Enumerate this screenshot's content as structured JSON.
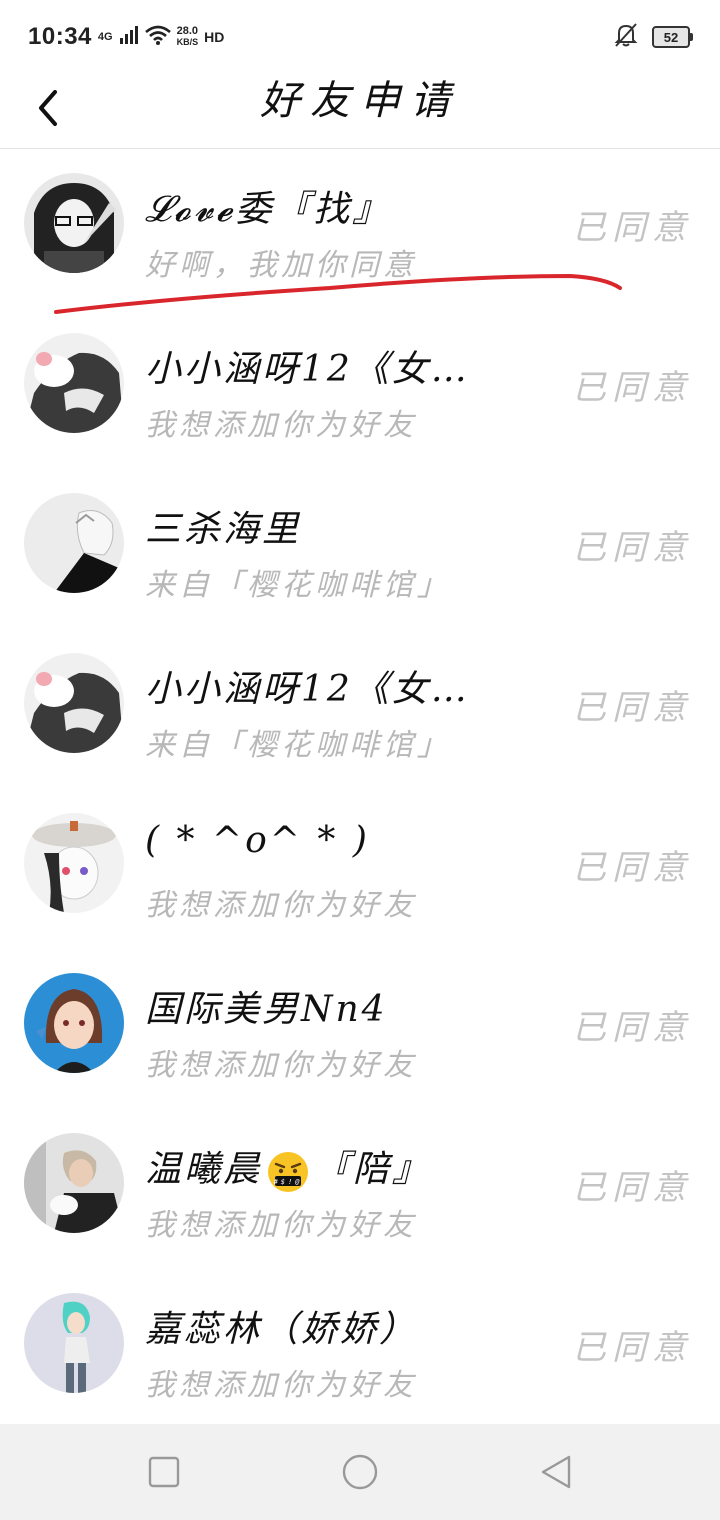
{
  "status_bar": {
    "time": "10:34",
    "network": "4G",
    "speed_value": "28.0",
    "speed_unit": "KB/S",
    "hd": "HD",
    "battery": "52"
  },
  "header": {
    "title": "好友申请"
  },
  "requests": [
    {
      "name": "𝓛𝓸𝓿𝓮委『找』",
      "message": "好啊，我加你同意",
      "status": "已同意"
    },
    {
      "name": "小小涵呀12《女…",
      "message": "我想添加你为好友",
      "status": "已同意"
    },
    {
      "name": "三杀海里",
      "message": "来自「樱花咖啡馆」",
      "status": "已同意"
    },
    {
      "name": "小小涵呀12《女…",
      "message": "来自「樱花咖啡馆」",
      "status": "已同意"
    },
    {
      "name": "( * ^o^ * )",
      "message": "我想添加你为好友",
      "status": "已同意"
    },
    {
      "name": "国际美男Nn4",
      "message": "我想添加你为好友",
      "status": "已同意"
    },
    {
      "name_prefix": "温曦晨",
      "name_suffix": "『陪』",
      "message": "我想添加你为好友",
      "status": "已同意"
    },
    {
      "name": "嘉蕊林（娇娇）",
      "message": "我想添加你为好友",
      "status": "已同意"
    }
  ],
  "colors": {
    "status_text": "#c4c4c4",
    "message_text": "#b8b8b8",
    "annotation_red": "#d9262c",
    "nav_bar_bg": "#f1f1f1"
  },
  "icons": {
    "back": "chevron-left-icon",
    "nav_recent": "square-icon",
    "nav_home": "circle-icon",
    "nav_back": "triangle-back-icon",
    "mute": "bell-off-icon"
  }
}
